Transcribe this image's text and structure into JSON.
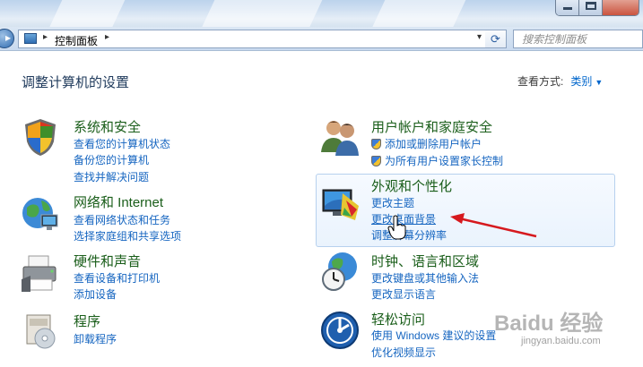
{
  "window": {
    "nav": {
      "breadcrumb": "控制面板",
      "search_placeholder": "搜索控制面板"
    }
  },
  "main": {
    "title": "调整计算机的设置",
    "view_by_label": "查看方式:",
    "view_by_value": "类别"
  },
  "categories": [
    {
      "title": "系统和安全",
      "links": [
        "查看您的计算机状态",
        "备份您的计算机",
        "查找并解决问题"
      ]
    },
    {
      "title": "网络和 Internet",
      "links": [
        "查看网络状态和任务",
        "选择家庭组和共享选项"
      ]
    },
    {
      "title": "硬件和声音",
      "links": [
        "查看设备和打印机",
        "添加设备"
      ]
    },
    {
      "title": "程序",
      "links": [
        "卸载程序"
      ]
    },
    {
      "title": "用户帐户和家庭安全",
      "links": [
        "添加或删除用户帐户",
        "为所有用户设置家长控制"
      ]
    },
    {
      "title": "外观和个性化",
      "links": [
        "更改主题",
        "更改桌面背景",
        "调整屏幕分辨率"
      ]
    },
    {
      "title": "时钟、语言和区域",
      "links": [
        "更改键盘或其他输入法",
        "更改显示语言"
      ]
    },
    {
      "title": "轻松访问",
      "links": [
        "使用 Windows 建议的设置",
        "优化视频显示"
      ]
    }
  ],
  "watermark": {
    "logo": "Baidu 经验",
    "url": "jingyan.baidu.com"
  },
  "colors": {
    "category_title": "#1a5e1a",
    "link": "#1565c0",
    "annotation_arrow": "#d6191e"
  }
}
